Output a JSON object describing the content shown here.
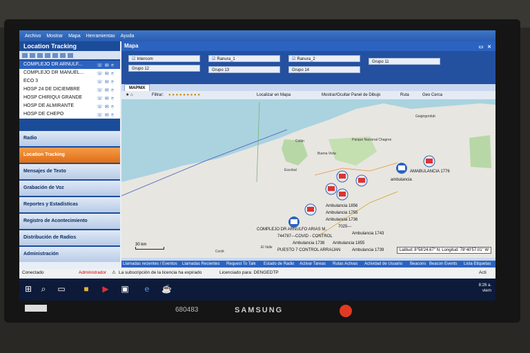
{
  "menu": [
    "Archivo",
    "Mostrar",
    "Mapa",
    "Herramientas",
    "Ayuda"
  ],
  "left": {
    "title": "Location Tracking",
    "units": [
      {
        "name": "COMPLEJO DR ARNULF...",
        "selected": true
      },
      {
        "name": "COMPLEJO DR MANUEL...",
        "selected": false
      },
      {
        "name": "ECO 3",
        "selected": false
      },
      {
        "name": "HOSP 24 DE DICIEMBRE",
        "selected": false
      },
      {
        "name": "HOSP CHIRIQUI GRANDE",
        "selected": false
      },
      {
        "name": "HOSP DE ALMIRANTE",
        "selected": false
      },
      {
        "name": "HOSP DE CHEPO",
        "selected": false
      }
    ],
    "nav": [
      "Radio",
      "Location Tracking",
      "Mensajes de Texto",
      "Grabación de Voz",
      "Reportes y Estadísticas",
      "Registro de Acontecimiento",
      "Distribución de Radios",
      "Administración"
    ],
    "nav_active": 1
  },
  "map": {
    "title": "Mapa",
    "groups": [
      {
        "label": "Intercom",
        "checked": true
      },
      {
        "label": "Ranura_1",
        "checked": true
      },
      {
        "label": "Ranura_2",
        "checked": true
      },
      {
        "label": "Grupo 11",
        "checked": false
      },
      {
        "label": "Grupo 12",
        "checked": false
      },
      {
        "label": "Grupo 13",
        "checked": false
      },
      {
        "label": "Grupo 14",
        "checked": false
      }
    ],
    "tab": "MAPNIX",
    "toolbar": {
      "filter": "Filtrar:",
      "locate": "Localizar en Mapa",
      "drawing": "Mostrar/Ocultar Panel de Dibujo",
      "route": "Ruta",
      "geofence": "Geo Cerca"
    },
    "places": [
      "Colón",
      "Buena Vista",
      "Parque Nacional Chagres",
      "Escobal",
      "Gaigirgordub",
      "Coclé",
      "El Valle"
    ],
    "markers": [
      "AMABULANCIA 1776",
      "ambulancia",
      "Ambulancia 1856",
      "Ambulancia 1755",
      "Ambulancia 1736",
      "7025---",
      "Ambulancia 1743",
      "COMPLEJO DR ARNULFO ARIAS M.",
      "744787---COVID - CONTROL",
      "Ambulancia 1738",
      "Ambulancia 1855",
      "PUESTO 7 CONTROL ARRAIJAN",
      "Ambulancia 1739"
    ],
    "scale": "30 km",
    "coords": "Latitud: 8°58'24.67\" N; Longitud: 78°40'57.01\" W"
  },
  "bottom_tabs": [
    "Llamadas recientes / Eventos",
    "Llamadas Recientes",
    "Request To Talk",
    "Estado de Radio",
    "Activar Tareas",
    "Rutas Activas",
    "Actividad de Usuario",
    "Beacons",
    "Beacon Events",
    "Lista Etiquetas"
  ],
  "status": {
    "connected": "Conectado",
    "user": "Administrador",
    "license_warning": "La subscripción de la licencia ha expirado",
    "licensed": "Licenciado para: DENGEDTP",
    "active": "Acti"
  },
  "taskbar": {
    "time": "8:26 a.",
    "day": "viern"
  },
  "monitor": {
    "brand": "SAMSUNG",
    "serial": "680483"
  }
}
